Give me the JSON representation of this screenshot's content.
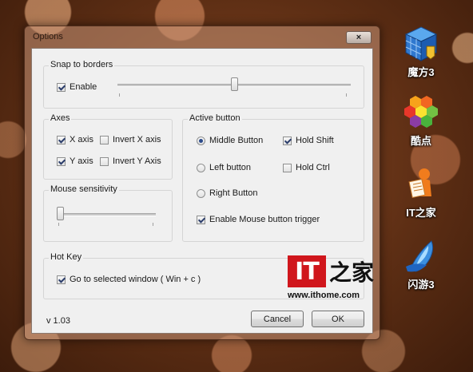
{
  "window": {
    "title": "Options",
    "close_glyph": "×"
  },
  "snap": {
    "title": "Snap to borders",
    "enable_label": "Enable",
    "enable_checked": true,
    "slider_value": 0.5
  },
  "axes": {
    "title": "Axes",
    "x_axis_label": "X axis",
    "x_axis_checked": true,
    "invert_x_label": "Invert X axis",
    "invert_x_checked": false,
    "y_axis_label": "Y axis",
    "y_axis_checked": true,
    "invert_y_label": "Invert Y Axis",
    "invert_y_checked": false
  },
  "active_button": {
    "title": "Active button",
    "middle_label": "Middle Button",
    "left_label": "Left button",
    "right_label": "Right Button",
    "selected": "middle",
    "hold_shift_label": "Hold Shift",
    "hold_shift_checked": true,
    "hold_ctrl_label": "Hold Ctrl",
    "hold_ctrl_checked": false,
    "enable_trigger_label": "Enable Mouse button trigger",
    "enable_trigger_checked": true
  },
  "mouse_sensitivity": {
    "title": "Mouse sensitivity",
    "slider_value": 0.0
  },
  "hotkey": {
    "title": "Hot Key",
    "goto_label": "Go to selected window ( Win + c )",
    "goto_checked": true
  },
  "footer": {
    "version": "v 1.03",
    "cancel_label": "Cancel",
    "ok_label": "OK"
  },
  "watermark": {
    "logo_text": "IT",
    "logo_zh": "之家",
    "url": "www.ithome.com"
  },
  "desktop_icons": [
    {
      "label": "魔方3",
      "icon": "rubiks-cube-icon"
    },
    {
      "label": "酷点",
      "icon": "hexagon-cluster-icon"
    },
    {
      "label": "IT之家",
      "icon": "reader-figure-icon"
    },
    {
      "label": "闪游3",
      "icon": "flame-swirl-icon"
    }
  ]
}
